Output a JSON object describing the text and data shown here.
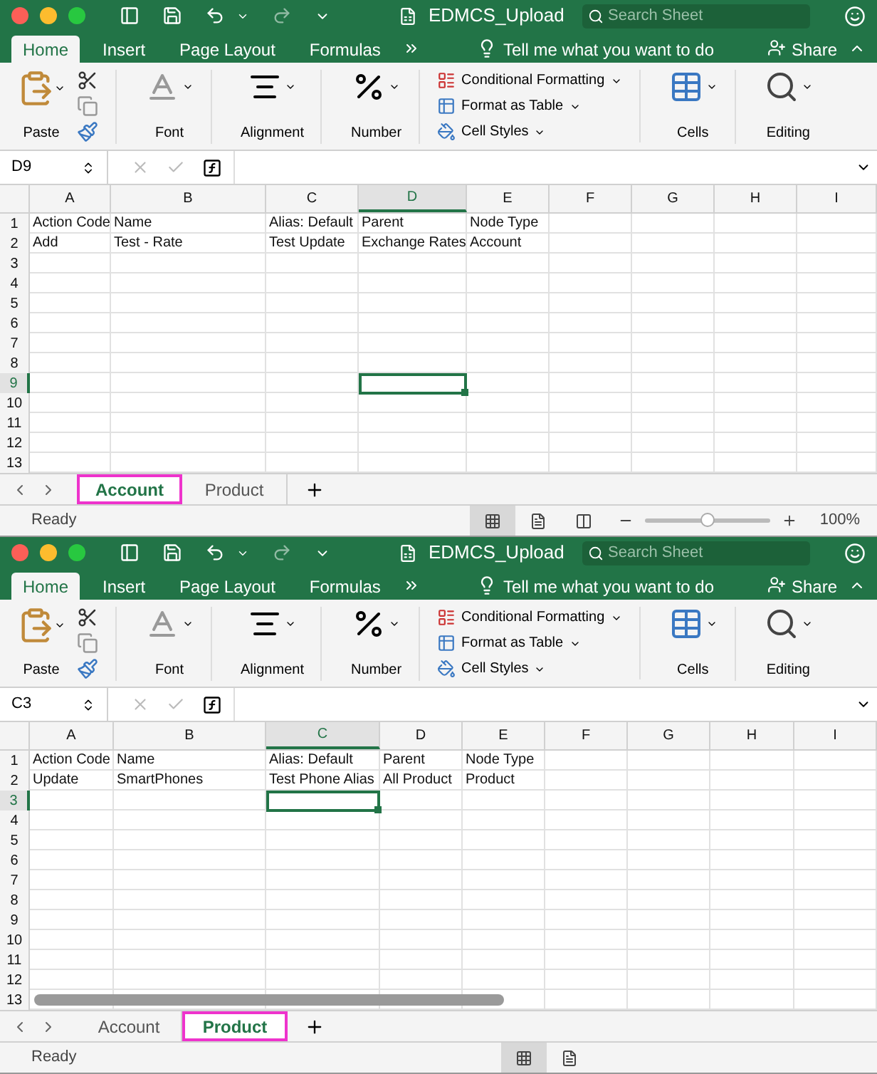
{
  "windows": [
    {
      "title": "EDMCS_Upload",
      "search": {
        "placeholder": "Search Sheet"
      },
      "tabs": [
        {
          "label": "Home",
          "selected": true
        },
        {
          "label": "Insert",
          "selected": false
        },
        {
          "label": "Page Layout",
          "selected": false
        },
        {
          "label": "Formulas",
          "selected": false
        }
      ],
      "tell_me": "Tell me what you want to do",
      "share": "Share",
      "ribbon": [
        {
          "kind": "paste",
          "label": "Paste"
        },
        {
          "kind": "font",
          "label": "Font"
        },
        {
          "kind": "alignment",
          "label": "Alignment"
        },
        {
          "kind": "number",
          "label": "Number"
        },
        {
          "kind": "styles",
          "items": [
            "Conditional Formatting",
            "Format as Table",
            "Cell Styles"
          ]
        },
        {
          "kind": "cells",
          "label": "Cells"
        },
        {
          "kind": "editing",
          "label": "Editing"
        }
      ],
      "name_box": "D9",
      "columns": [
        {
          "label": "A",
          "selected": false
        },
        {
          "label": "B",
          "selected": false
        },
        {
          "label": "C",
          "selected": false
        },
        {
          "label": "D",
          "selected": true
        },
        {
          "label": "E",
          "selected": false
        },
        {
          "label": "F",
          "selected": false
        },
        {
          "label": "G",
          "selected": false
        },
        {
          "label": "H",
          "selected": false
        },
        {
          "label": "I",
          "selected": false
        }
      ],
      "rows": [
        {
          "label": "1",
          "selected": false,
          "cells": [
            "Action Code",
            "Name",
            "Alias: Default",
            "Parent",
            "Node Type"
          ]
        },
        {
          "label": "2",
          "selected": false,
          "cells": [
            "Add",
            "Test - Rate",
            "Test Update",
            "Exchange Rates",
            "Account"
          ]
        },
        {
          "label": "3",
          "selected": false
        },
        {
          "label": "4",
          "selected": false
        },
        {
          "label": "5",
          "selected": false
        },
        {
          "label": "6",
          "selected": false
        },
        {
          "label": "7",
          "selected": false
        },
        {
          "label": "8",
          "selected": false
        },
        {
          "label": "9",
          "selected": true
        },
        {
          "label": "10",
          "selected": false
        },
        {
          "label": "11",
          "selected": false
        },
        {
          "label": "12",
          "selected": false
        },
        {
          "label": "13",
          "selected": false
        }
      ],
      "scrollbar": false,
      "sheets": [
        {
          "label": "Account",
          "selected": true
        },
        {
          "label": "Product",
          "selected": false
        }
      ],
      "status": "Ready",
      "views": [
        {
          "kind": "normal",
          "selected": true
        },
        {
          "kind": "layout",
          "selected": false
        },
        {
          "kind": "break",
          "selected": false
        }
      ],
      "zoom": {
        "level": 0.5,
        "reading": "100%"
      }
    },
    {
      "title": "EDMCS_Upload",
      "search": {
        "placeholder": "Search Sheet"
      },
      "tabs": [
        {
          "label": "Home",
          "selected": true
        },
        {
          "label": "Insert",
          "selected": false
        },
        {
          "label": "Page Layout",
          "selected": false
        },
        {
          "label": "Formulas",
          "selected": false
        }
      ],
      "tell_me": "Tell me what you want to do",
      "share": "Share",
      "ribbon": [
        {
          "kind": "paste",
          "label": "Paste"
        },
        {
          "kind": "font",
          "label": "Font"
        },
        {
          "kind": "alignment",
          "label": "Alignment"
        },
        {
          "kind": "number",
          "label": "Number"
        },
        {
          "kind": "styles",
          "items": [
            "Conditional Formatting",
            "Format as Table",
            "Cell Styles"
          ]
        },
        {
          "kind": "cells",
          "label": "Cells"
        },
        {
          "kind": "editing",
          "label": "Editing"
        }
      ],
      "name_box": "C3",
      "columns": [
        {
          "label": "A",
          "selected": false
        },
        {
          "label": "B",
          "selected": false
        },
        {
          "label": "C",
          "selected": true
        },
        {
          "label": "D",
          "selected": false
        },
        {
          "label": "E",
          "selected": false
        },
        {
          "label": "F",
          "selected": false
        },
        {
          "label": "G",
          "selected": false
        },
        {
          "label": "H",
          "selected": false
        },
        {
          "label": "I",
          "selected": false
        }
      ],
      "rows": [
        {
          "label": "1",
          "selected": false,
          "cells": [
            "Action Code",
            "Name",
            "Alias: Default",
            "Parent",
            "Node Type"
          ]
        },
        {
          "label": "2",
          "selected": false,
          "cells": [
            "Update",
            "SmartPhones",
            "Test Phone Alias",
            "All Product",
            "Product"
          ]
        },
        {
          "label": "3",
          "selected": true
        },
        {
          "label": "4",
          "selected": false
        },
        {
          "label": "5",
          "selected": false
        },
        {
          "label": "6",
          "selected": false
        },
        {
          "label": "7",
          "selected": false
        },
        {
          "label": "8",
          "selected": false
        },
        {
          "label": "9",
          "selected": false
        },
        {
          "label": "10",
          "selected": false
        },
        {
          "label": "11",
          "selected": false
        },
        {
          "label": "12",
          "selected": false
        },
        {
          "label": "13",
          "selected": false
        }
      ],
      "scrollbar": true,
      "sheets": [
        {
          "label": "Account",
          "selected": false
        },
        {
          "label": "Product",
          "selected": true
        }
      ],
      "status": "Ready",
      "views": [
        {
          "kind": "normal",
          "selected": true
        },
        {
          "kind": "layout",
          "selected": false
        }
      ]
    }
  ]
}
